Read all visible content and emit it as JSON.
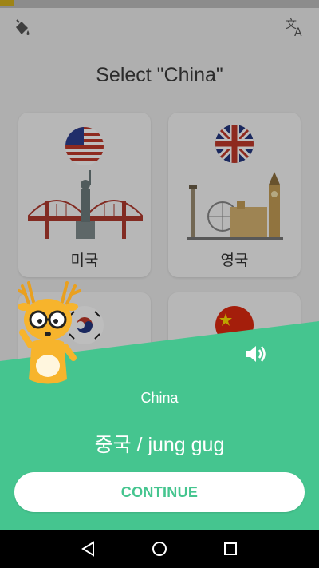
{
  "prompt": {
    "title": "Select \"China\""
  },
  "cards": [
    {
      "name": "미국",
      "flag": "usa-flag-icon"
    },
    {
      "name": "영국",
      "flag": "uk-flag-icon"
    },
    {
      "name": "",
      "flag": "south-korea-flag-icon"
    },
    {
      "name": "",
      "flag": "china-flag-icon"
    }
  ],
  "result": {
    "word": "China",
    "translation": "중국 / jung gug",
    "continue_label": "CONTINUE",
    "accent_color": "#45c58f"
  },
  "topbar": {
    "left_icon": "paint-bucket-icon",
    "right_icon": "translate-icon"
  },
  "navbar": {
    "icons": [
      "back-triangle-icon",
      "home-circle-icon",
      "recents-square-icon"
    ]
  }
}
